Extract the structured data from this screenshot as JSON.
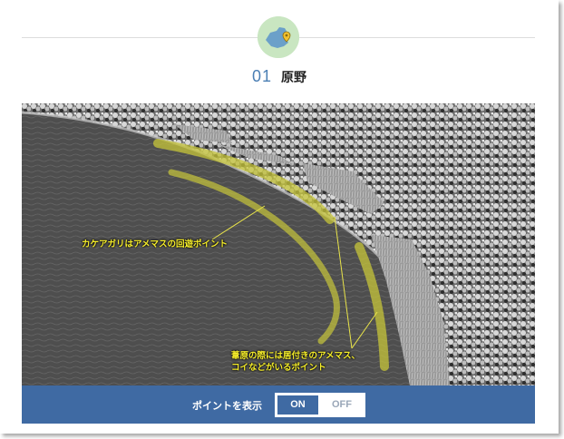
{
  "section": {
    "number": "01",
    "title": "原野",
    "badge_icon": "map-pin-icon"
  },
  "photo": {
    "annotations": [
      "カケアガリはアメマスの回遊ポイント",
      "葦原の際には居付きのアメマス、",
      "コイなどがいるポイント"
    ],
    "highlight_color": "#c7c63a",
    "annotation_color": "#f6ee2a"
  },
  "controls": {
    "label": "ポイントを表示",
    "toggle": {
      "on_label": "ON",
      "off_label": "OFF",
      "selected": "ON"
    },
    "bar_color": "#3f6aa3"
  }
}
